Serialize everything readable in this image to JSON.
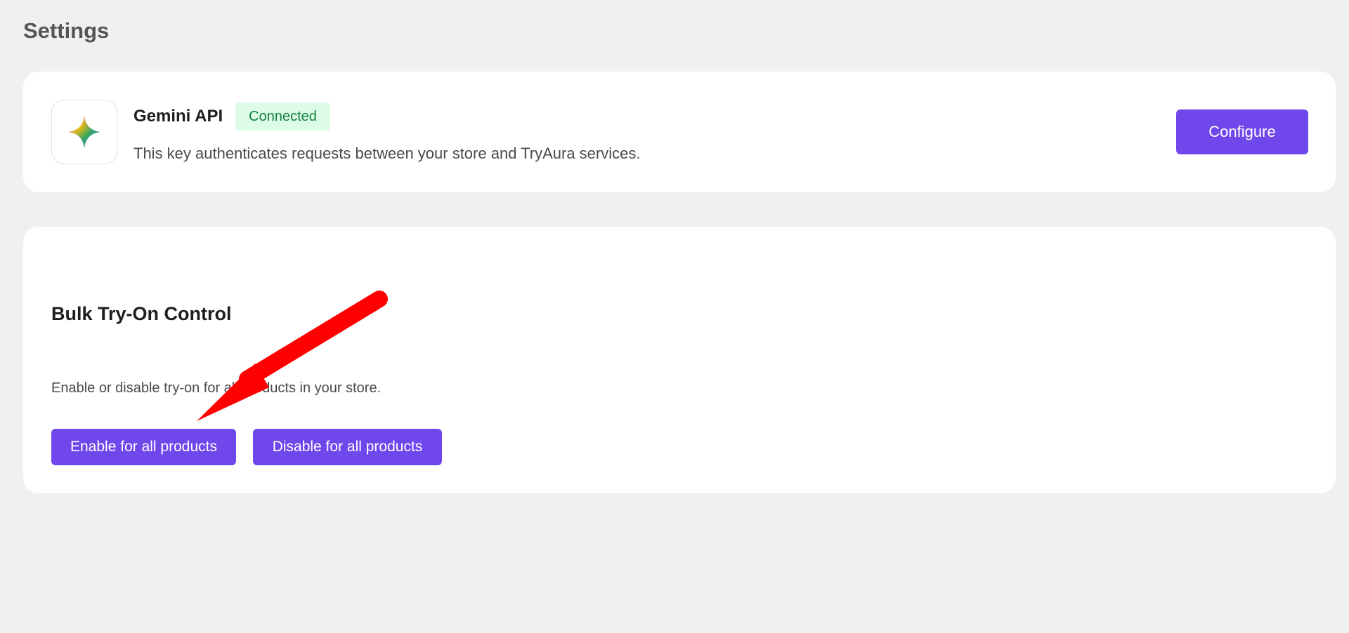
{
  "page": {
    "title": "Settings"
  },
  "api_card": {
    "logo_icon": "gemini-sparkle-icon",
    "title": "Gemini API",
    "status": "Connected",
    "description": "This key authenticates requests between your store and TryAura services.",
    "configure_label": "Configure"
  },
  "bulk_card": {
    "title": "Bulk Try-On Control",
    "description": "Enable or disable try-on for all products in your store.",
    "enable_label": "Enable for all products",
    "disable_label": "Disable for all products"
  },
  "annotation": {
    "arrow_icon": "red-arrow-icon",
    "color": "#ff0000"
  },
  "colors": {
    "background": "#f0f0f0",
    "card": "#ffffff",
    "accent": "#7047eb",
    "badge_bg": "#dcfce7",
    "badge_text": "#15803d"
  }
}
